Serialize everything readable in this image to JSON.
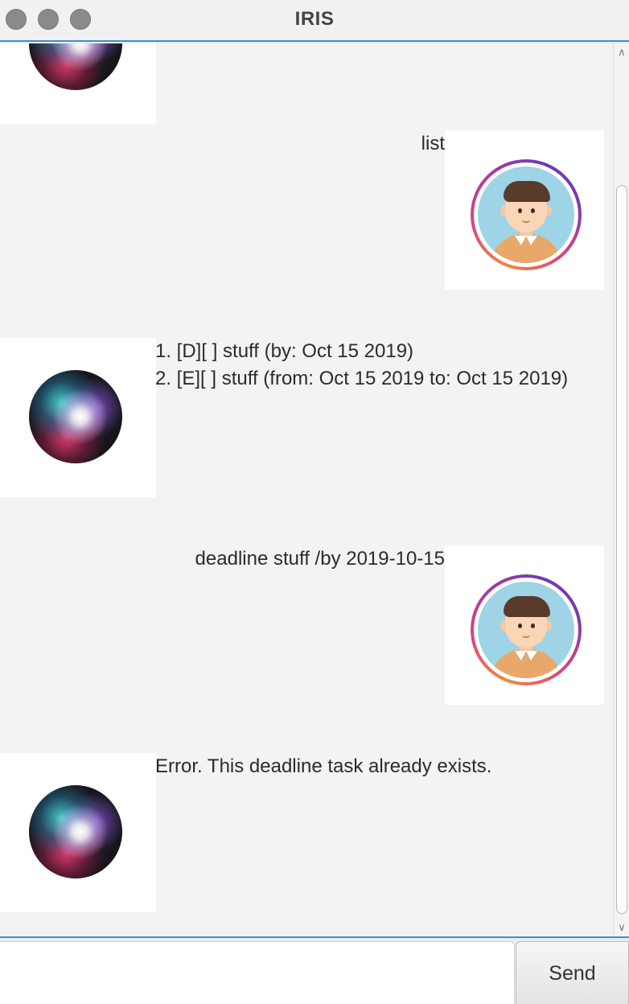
{
  "window": {
    "title": "IRIS"
  },
  "messages": [
    {
      "sender": "user",
      "text": "list"
    },
    {
      "sender": "iris",
      "lines": [
        "1. [D][ ] stuff (by: Oct 15 2019)",
        "2. [E][ ] stuff (from: Oct 15 2019 to: Oct 15 2019)"
      ]
    },
    {
      "sender": "user",
      "text": "deadline stuff /by 2019-10-15"
    },
    {
      "sender": "iris",
      "text": "Error. This deadline task already exists."
    }
  ],
  "input": {
    "value": "",
    "placeholder": ""
  },
  "send_button": {
    "label": "Send"
  },
  "icons": {
    "bot_avatar": "siri-orb-icon",
    "user_avatar": "user-avatar-icon"
  },
  "colors": {
    "accent": "#3b8fd0",
    "background": "#f3f3f3",
    "card": "#ffffff"
  }
}
